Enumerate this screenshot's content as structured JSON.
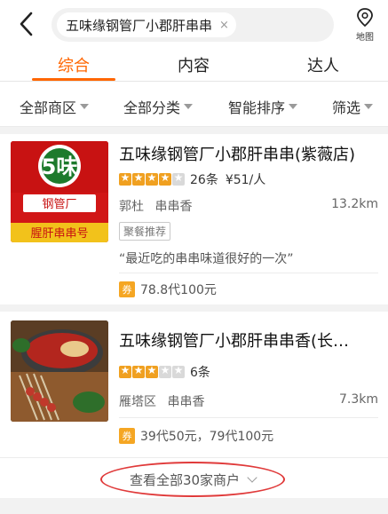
{
  "search": {
    "query_chip": "五味缘钢管厂小郡肝串串",
    "clear_symbol": "×",
    "map_label": "地图"
  },
  "tabs": [
    {
      "label": "综合",
      "active": true
    },
    {
      "label": "内容",
      "active": false
    },
    {
      "label": "达人",
      "active": false
    }
  ],
  "filters": [
    {
      "label": "全部商区"
    },
    {
      "label": "全部分类"
    },
    {
      "label": "智能排序"
    },
    {
      "label": "筛选"
    }
  ],
  "shops": [
    {
      "name": "五味缘钢管厂小郡肝串串(紫薇店)",
      "stars": 4,
      "star_max": 5,
      "reviews": "26条",
      "price": "¥51/人",
      "area": "郭杜",
      "category": "串串香",
      "distance": "13.2km",
      "tag": "聚餐推荐",
      "quote": "“最近吃的串串味道很好的一次”",
      "deal_badge": "券",
      "deal_text": "78.8代100元",
      "thumb_logo_text": "5味",
      "thumb_sign_text": "钢管厂",
      "thumb_bottom_text": "腥肝串串号"
    },
    {
      "name": "五味缘钢管厂小郡肝串串香(长…",
      "stars": 3,
      "star_max": 5,
      "reviews": "6条",
      "area": "雁塔区",
      "category": "串串香",
      "distance": "7.3km",
      "deal_badge": "券",
      "deal_text": "39代50元，79代100元"
    }
  ],
  "view_all": {
    "label": "查看全部30家商户"
  },
  "colors": {
    "accent": "#ff6600",
    "star": "#f0a020",
    "deal_badge": "#f5a623",
    "highlight_circle": "#e03a3a"
  }
}
